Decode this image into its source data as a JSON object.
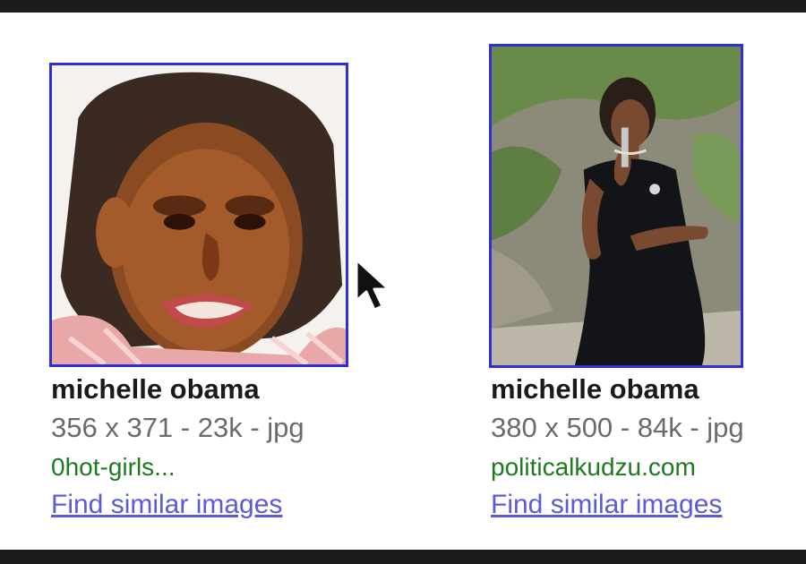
{
  "results": [
    {
      "title": "michelle obama",
      "meta": "356 x 371 - 23k - jpg",
      "domain": "0hot-girls...",
      "similar_label": "Find similar images"
    },
    {
      "title": "michelle obama",
      "meta": "380 x 500 - 84k - jpg",
      "domain": "politicalkudzu.com",
      "similar_label": "Find similar images"
    }
  ],
  "colors": {
    "thumb_border": "#2f2fd6",
    "domain_green": "#1e7a1e",
    "link_blue": "#5b5bd8"
  },
  "icons": {
    "cursor": "mouse-pointer-icon"
  }
}
